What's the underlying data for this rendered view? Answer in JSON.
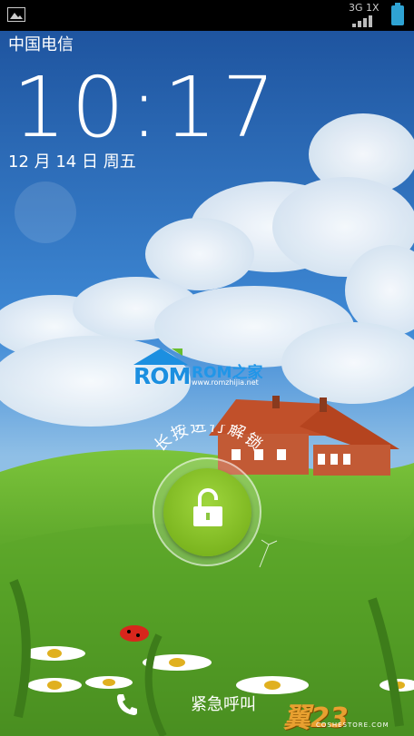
{
  "statusbar": {
    "network_type": "3G 1X",
    "gallery_icon": "picture-icon",
    "signal_icon": "signal-bars-icon",
    "battery_icon": "battery-icon"
  },
  "lockscreen": {
    "carrier": "中国电信",
    "time": "10:17",
    "date": "12 月 14 日 周五",
    "unlock_hint": "长按进行解锁",
    "unlock_icon": "unlocked-padlock-icon",
    "emergency_label": "紧急呼叫",
    "emergency_icon": "phone-icon"
  },
  "watermarks": {
    "rom_logo_left": "ROM",
    "rom_logo_right": "ROM之家",
    "rom_url": "www.romzhijia.net",
    "corner_logo": "翼23",
    "corner_url": "COSHESTORE.COM"
  },
  "colors": {
    "unlock_green": "#8cc63f",
    "battery_blue": "#2fa3d3",
    "sky_blue": "#3b7fd0",
    "grass_green": "#5aa329"
  }
}
